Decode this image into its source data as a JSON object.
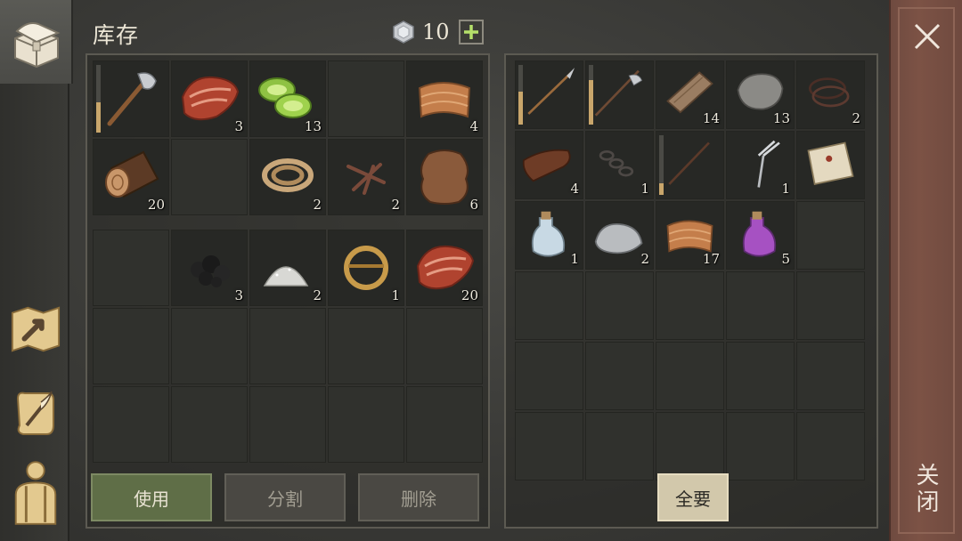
{
  "header": {
    "title": "库存",
    "currency_value": "10"
  },
  "left_nav": [
    {
      "name": "chest-icon",
      "active": true
    },
    {
      "name": "crafting-map-icon"
    },
    {
      "name": "scroll-quill-icon"
    },
    {
      "name": "character-icon"
    }
  ],
  "inventory": {
    "top_rows": [
      [
        {
          "item": "axe",
          "durability": 0.45
        },
        {
          "item": "raw-meat",
          "count": "3"
        },
        {
          "item": "cucumber-slices",
          "count": "13"
        },
        {
          "item": ""
        },
        {
          "item": "leather-strips",
          "count": "4"
        }
      ],
      [
        {
          "item": "log",
          "count": "20"
        },
        {
          "item": ""
        },
        {
          "item": "rope",
          "count": "2"
        },
        {
          "item": "nails",
          "count": "2"
        },
        {
          "item": "animal-hide",
          "count": "6"
        }
      ]
    ],
    "bottom_rows": [
      [
        {
          "item": ""
        },
        {
          "item": "coal",
          "count": "3"
        },
        {
          "item": "salt",
          "count": "2"
        },
        {
          "item": "brass-ring",
          "count": "1"
        },
        {
          "item": "raw-meat",
          "count": "20"
        }
      ]
    ]
  },
  "storage": {
    "rows": [
      [
        {
          "item": "spear",
          "durability": 0.55
        },
        {
          "item": "halberd",
          "durability": 0.75
        },
        {
          "item": "plank",
          "count": "14"
        },
        {
          "item": "stone",
          "count": "13"
        },
        {
          "item": "wire",
          "count": "2"
        }
      ],
      [
        {
          "item": "leather",
          "count": "4"
        },
        {
          "item": "chain",
          "count": "1"
        },
        {
          "item": "stick",
          "durability": 0.2
        },
        {
          "item": "fork",
          "count": "1"
        },
        {
          "item": "map-scrap"
        }
      ],
      [
        {
          "item": "water-flask",
          "count": "1"
        },
        {
          "item": "iron-ore",
          "count": "2"
        },
        {
          "item": "leather-strips",
          "count": "17"
        },
        {
          "item": "purple-potion",
          "count": "5"
        },
        {
          "item": ""
        }
      ]
    ]
  },
  "buttons": {
    "use": "使用",
    "split": "分割",
    "delete": "删除",
    "take_all": "全要"
  },
  "close": {
    "label": "关闭"
  },
  "colors": {
    "accent_green": "#5f6e47",
    "take_btn": "#d2c8ab",
    "close_strip": "#7c5245",
    "plus_green": "#b5e06a"
  }
}
